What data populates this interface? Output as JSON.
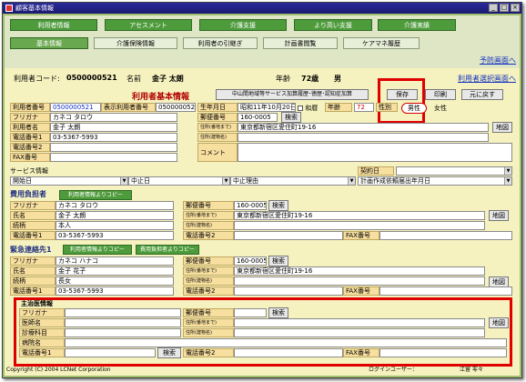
{
  "window": {
    "title": "顧客基本情報"
  },
  "nav_row1": [
    "利用者情報",
    "アセスメント",
    "介護支援",
    "より高い支援",
    "介護実績"
  ],
  "nav_row2": [
    "基本情報",
    "介護保険情報",
    "利用者の引継ぎ",
    "計画書閲覧",
    "ケアマネ履歴"
  ],
  "links": {
    "preview": "予防画面へ",
    "user_select": "利用者選択画面へ"
  },
  "info": {
    "user_code_label": "利用者コード:",
    "user_code": "0500000521",
    "name_label": "名前",
    "name": "金子 太朗",
    "age_label": "年齢",
    "age": "72歳",
    "sex": "男"
  },
  "section_title": "利用者基本情報",
  "toolbar": {
    "history_btn": "中山間地域等サービス加算履歴･徳歴･認知症加算",
    "save": "保存",
    "print": "印刷",
    "back": "元に戻す"
  },
  "user": {
    "no_label": "利用者番号",
    "no": "0500000521",
    "disp_label": "表示利用者番号",
    "disp": "0500000521",
    "birth_label": "生年月日",
    "birth": "昭和11年10月20日",
    "era": "和暦",
    "age_label": "年齢",
    "age": "72",
    "sex_label": "性別",
    "male": "男性",
    "female": "女性",
    "furigana_label": "フリガナ",
    "furigana": "カネコ タロウ",
    "name_label": "利用者名",
    "name": "金子 太朗",
    "tel1_label": "電話番号1",
    "tel1": "03-5367-5993",
    "tel2_label": "電話番号2",
    "fax_label": "FAX番号",
    "zip_label": "郵便番号",
    "zip": "160-0005",
    "search": "検索",
    "addr1_label": "住所(番地まで)",
    "addr1": "東京都新宿区愛住町19-16",
    "addr2_label": "住所(建物名)",
    "comment_label": "コメント",
    "map": "地図"
  },
  "service": {
    "title": "サービス情報",
    "contract_label": "契約日",
    "start": "開始日",
    "stop": "中止日",
    "reason": "中止理由",
    "plan": "計画作成依頼届出年月日"
  },
  "payer": {
    "title": "費用負担者",
    "copy_btn": "利用者情報よりコピー",
    "furigana_label": "フリガナ",
    "furigana": "カネコ タロウ",
    "name_label": "氏名",
    "name": "金子 太朗",
    "rel_label": "続柄",
    "rel": "本人",
    "tel1_label": "電話番号1",
    "tel1": "03-5367-5993",
    "zip_label": "郵便番号",
    "zip": "160-0005",
    "search": "検索",
    "addr1_label": "住所(番地まで)",
    "addr1": "東京都新宿区愛住町19-16",
    "addr2_label": "住所(建物名)",
    "tel2_label": "電話番号2",
    "fax_label": "FAX番号",
    "map": "地図"
  },
  "emergency": {
    "title": "緊急連絡先1",
    "copy_btn": "利用者情報よりコピー",
    "copy_btn2": "費用負担者よりコピー",
    "furigana_label": "フリガナ",
    "furigana": "カネコ ハナコ",
    "name_label": "氏名",
    "name": "金子 花子",
    "rel_label": "続柄",
    "rel": "長女",
    "tel1_label": "電話番号1",
    "tel1": "03-5367-5993",
    "zip_label": "郵便番号",
    "zip": "160-0005",
    "search": "検索",
    "addr1_label": "住所(番地まで)",
    "addr1": "東京都新宿区愛住町19-16",
    "addr2_label": "住所(建物名)",
    "tel2_label": "電話番号2",
    "fax_label": "FAX番号",
    "map": "地図"
  },
  "doctor": {
    "title": "主治医情報",
    "furigana_label": "フリガナ",
    "doctor_label": "医師名",
    "dept_label": "診療科目",
    "hospital_label": "病院名",
    "tel1_label": "電話番号1",
    "search_btn": "検索",
    "zip_label": "郵便番号",
    "search": "検索",
    "addr1_label": "住所(番地まで)",
    "addr2_label": "住所(建物名)",
    "tel2_label": "電話番号2",
    "fax_label": "FAX番号",
    "map": "地図"
  },
  "footer": {
    "copyright": "Copyright (C) 2004 LCNet Corporation",
    "login_label": "ログインユーザー：",
    "login_user": "江留 零々"
  }
}
